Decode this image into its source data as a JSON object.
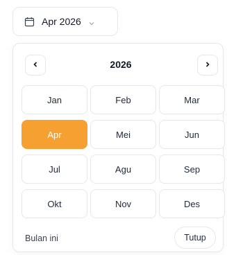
{
  "trigger": {
    "icon": "calendar-icon",
    "label": "Apr 2026",
    "chevron": "chevron-down-icon"
  },
  "picker": {
    "year": "2026",
    "prev_icon": "chevron-left-icon",
    "next_icon": "chevron-right-icon",
    "months": [
      "Jan",
      "Feb",
      "Mar",
      "Apr",
      "Mei",
      "Jun",
      "Jul",
      "Agu",
      "Sep",
      "Okt",
      "Nov",
      "Des"
    ],
    "selected_index": 3,
    "selected_color": "#f5a030",
    "this_month_label": "Bulan ini",
    "close_label": "Tutup"
  }
}
